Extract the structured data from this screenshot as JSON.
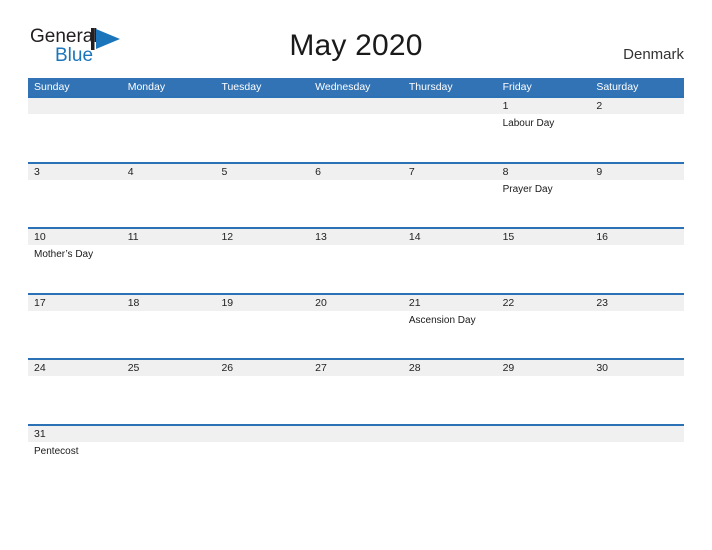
{
  "brand": {
    "name_part1": "General",
    "name_part2": "Blue",
    "mark_icon": "pennant-triangle-icon",
    "color_dark": "#231f20",
    "color_blue": "#1b75bb"
  },
  "header": {
    "title": "May 2020",
    "region": "Denmark"
  },
  "theme": {
    "header_band": "#3273b5",
    "row_rule": "#2a72b5",
    "date_strip": "#f0f0f0",
    "page_background": "#ffffff"
  },
  "calendar": {
    "weekdays": [
      "Sunday",
      "Monday",
      "Tuesday",
      "Wednesday",
      "Thursday",
      "Friday",
      "Saturday"
    ],
    "weeks": [
      {
        "days": [
          {
            "date": "",
            "event": ""
          },
          {
            "date": "",
            "event": ""
          },
          {
            "date": "",
            "event": ""
          },
          {
            "date": "",
            "event": ""
          },
          {
            "date": "",
            "event": ""
          },
          {
            "date": "1",
            "event": "Labour Day"
          },
          {
            "date": "2",
            "event": ""
          }
        ]
      },
      {
        "days": [
          {
            "date": "3",
            "event": ""
          },
          {
            "date": "4",
            "event": ""
          },
          {
            "date": "5",
            "event": ""
          },
          {
            "date": "6",
            "event": ""
          },
          {
            "date": "7",
            "event": ""
          },
          {
            "date": "8",
            "event": "Prayer Day"
          },
          {
            "date": "9",
            "event": ""
          }
        ]
      },
      {
        "days": [
          {
            "date": "10",
            "event": "Mother’s Day"
          },
          {
            "date": "11",
            "event": ""
          },
          {
            "date": "12",
            "event": ""
          },
          {
            "date": "13",
            "event": ""
          },
          {
            "date": "14",
            "event": ""
          },
          {
            "date": "15",
            "event": ""
          },
          {
            "date": "16",
            "event": ""
          }
        ]
      },
      {
        "days": [
          {
            "date": "17",
            "event": ""
          },
          {
            "date": "18",
            "event": ""
          },
          {
            "date": "19",
            "event": ""
          },
          {
            "date": "20",
            "event": ""
          },
          {
            "date": "21",
            "event": "Ascension Day"
          },
          {
            "date": "22",
            "event": ""
          },
          {
            "date": "23",
            "event": ""
          }
        ]
      },
      {
        "days": [
          {
            "date": "24",
            "event": ""
          },
          {
            "date": "25",
            "event": ""
          },
          {
            "date": "26",
            "event": ""
          },
          {
            "date": "27",
            "event": ""
          },
          {
            "date": "28",
            "event": ""
          },
          {
            "date": "29",
            "event": ""
          },
          {
            "date": "30",
            "event": ""
          }
        ]
      },
      {
        "days": [
          {
            "date": "31",
            "event": "Pentecost"
          },
          {
            "date": "",
            "event": ""
          },
          {
            "date": "",
            "event": ""
          },
          {
            "date": "",
            "event": ""
          },
          {
            "date": "",
            "event": ""
          },
          {
            "date": "",
            "event": ""
          },
          {
            "date": "",
            "event": ""
          }
        ]
      }
    ]
  }
}
